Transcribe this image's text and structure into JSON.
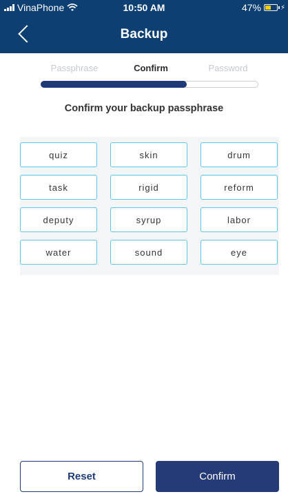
{
  "status_bar": {
    "carrier": "VinaPhone",
    "time": "10:50 AM",
    "battery": "47%",
    "battery_level": 0.47
  },
  "header": {
    "title": "Backup",
    "back_icon": "chevron-left-icon"
  },
  "steps": {
    "items": [
      {
        "label": "Passphrase",
        "state": "inactive"
      },
      {
        "label": "Confirm",
        "state": "active"
      },
      {
        "label": "Password",
        "state": "inactive"
      }
    ],
    "progress_fraction": 0.67
  },
  "heading": "Confirm your backup passphrase",
  "words": [
    "quiz",
    "skin",
    "drum",
    "task",
    "rigid",
    "reform",
    "deputy",
    "syrup",
    "labor",
    "water",
    "sound",
    "eye"
  ],
  "buttons": {
    "reset_label": "Reset",
    "confirm_label": "Confirm"
  },
  "colors": {
    "header_bg": "#0d3f73",
    "accent": "#253b78",
    "word_border": "#5cc6e6",
    "battery_fill": "#f5d000"
  }
}
